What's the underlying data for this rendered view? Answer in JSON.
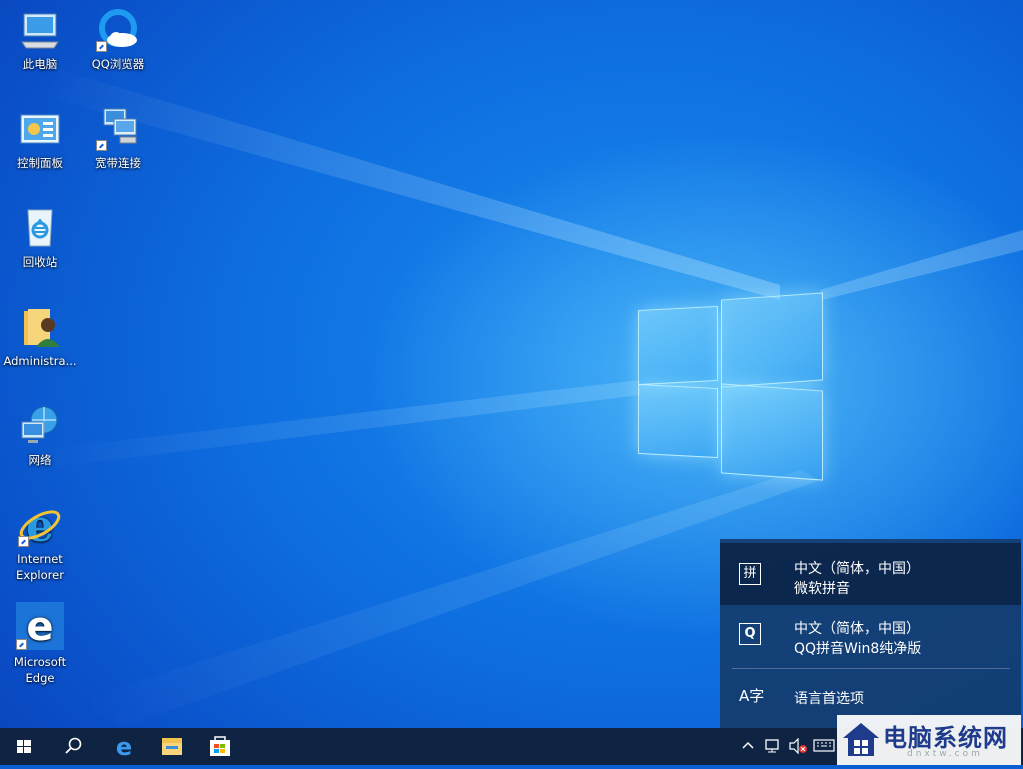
{
  "desktop": {
    "icons": [
      {
        "label": "此电脑",
        "icon": "this-pc-icon"
      },
      {
        "label": "QQ浏览器",
        "icon": "qq-browser-icon"
      },
      {
        "label": "控制面板",
        "icon": "control-panel-icon"
      },
      {
        "label": "宽带连接",
        "icon": "broadband-connection-icon"
      },
      {
        "label": "回收站",
        "icon": "recycle-bin-icon"
      },
      {
        "label": "Administra...",
        "icon": "user-folder-icon"
      },
      {
        "label": "网络",
        "icon": "network-icon"
      },
      {
        "label": "Internet Explorer",
        "icon": "internet-explorer-icon"
      },
      {
        "label": "Microsoft Edge",
        "icon": "microsoft-edge-icon"
      }
    ]
  },
  "language_flyout": {
    "items": [
      {
        "glyph": "拼",
        "line1": "中文（简体，中国）",
        "line2": "微软拼音",
        "selected": true
      },
      {
        "glyph": "Q",
        "line1": "中文（简体，中国）",
        "line2": "QQ拼音Win8纯净版",
        "selected": false
      }
    ],
    "preferences": {
      "glyph": "A字",
      "label": "语言首选项"
    }
  },
  "taskbar": {
    "buttons": [
      "windows-start-icon",
      "search-icon",
      "edge-icon",
      "file-explorer-icon",
      "store-icon"
    ],
    "tray": [
      "chevron-up-icon",
      "network-icon",
      "volume-muted-icon",
      "keyboard-icon"
    ]
  },
  "watermark": {
    "text": "电脑系统网",
    "sub": "dnxtw.com"
  },
  "colors": {
    "accent": "#0e6fe0",
    "taskbar": "#0e2442",
    "flyout": "#143c6e"
  }
}
